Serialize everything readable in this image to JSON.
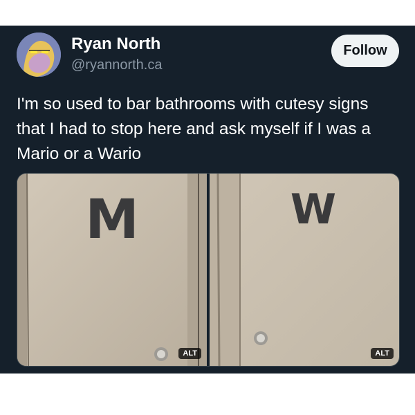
{
  "author": {
    "name": "Ryan North",
    "handle": "@ryannorth.ca",
    "avatar_icon": "avatar-icon"
  },
  "follow_button": {
    "label": "Follow"
  },
  "tweet": {
    "text": "I'm so used to bar bathrooms with cutesy signs that I had to stop here and ask myself if I was a Mario or a Wario"
  },
  "media": {
    "photos": [
      {
        "letter": "M",
        "alt_label": "ALT"
      },
      {
        "letter": "W",
        "alt_label": "ALT"
      }
    ]
  },
  "colors": {
    "background": "#15202b",
    "text": "#ffffff",
    "secondary_text": "#8b98a5",
    "follow_bg": "#eff3f4",
    "door": "#c9bfb0",
    "letter": "#3a3a3c"
  }
}
